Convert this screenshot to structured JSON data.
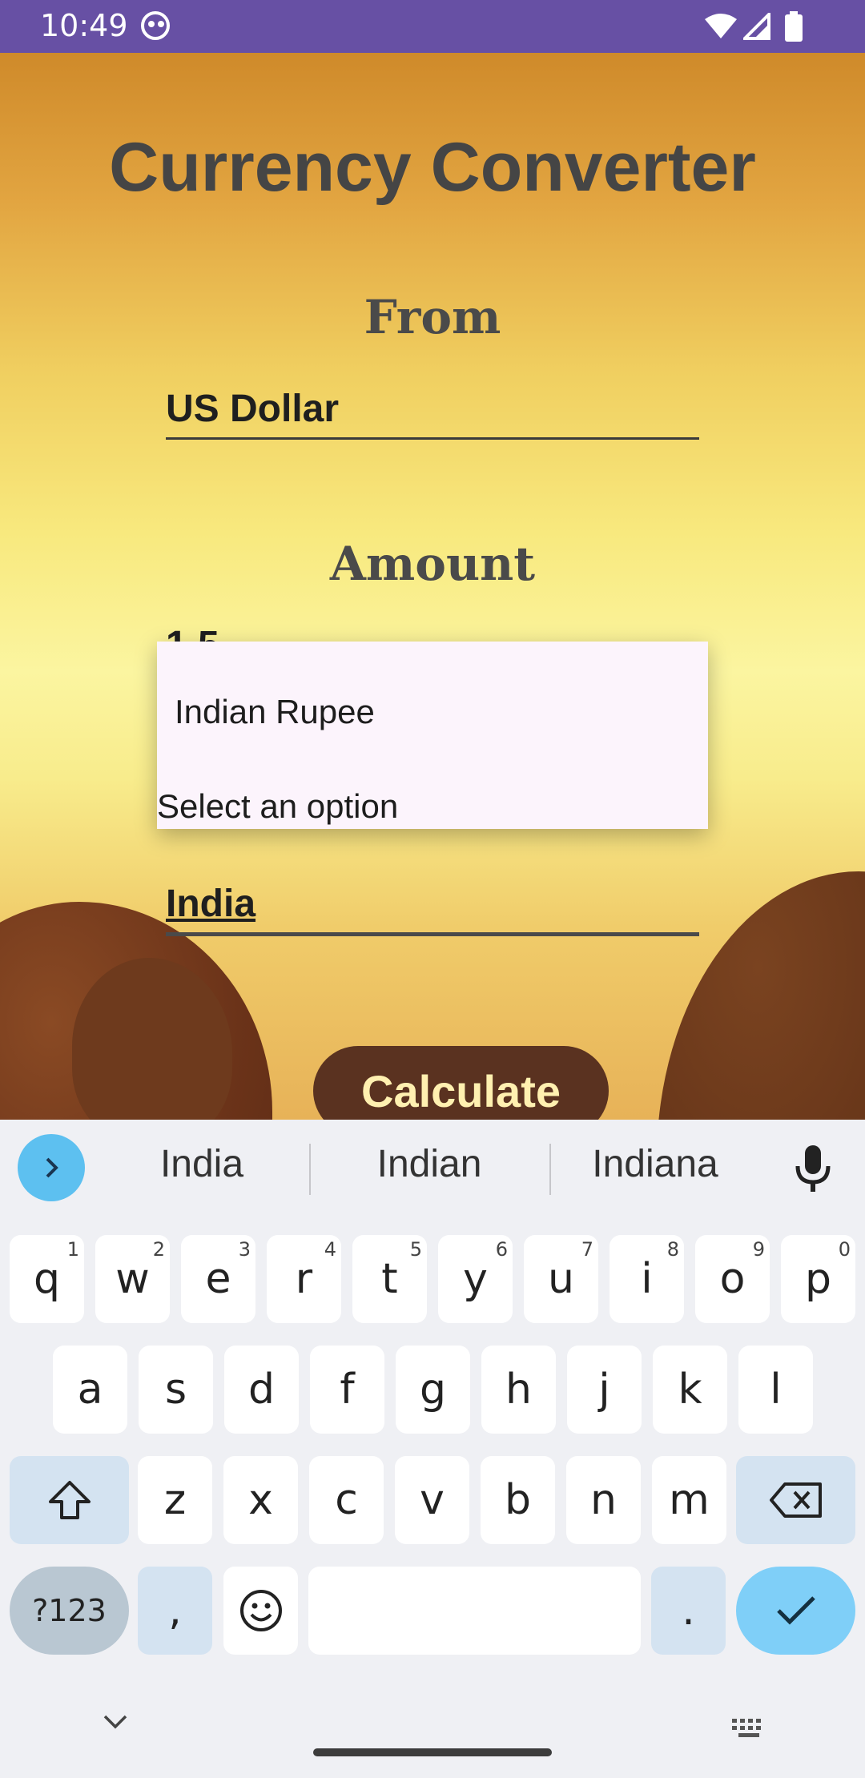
{
  "status_bar": {
    "time": "10:49"
  },
  "app": {
    "title": "Currency Converter",
    "from_label": "From",
    "from_value": "US Dollar",
    "amount_label": "Amount",
    "amount_value_partial": "1.5",
    "to_value": "India",
    "calculate_label": "Calculate"
  },
  "dropdown": {
    "option": "Indian Rupee",
    "hint": "Select an option"
  },
  "keyboard": {
    "suggestions": [
      "India",
      "Indian",
      "Indiana"
    ],
    "row1": [
      {
        "k": "q",
        "s": "1"
      },
      {
        "k": "w",
        "s": "2"
      },
      {
        "k": "e",
        "s": "3"
      },
      {
        "k": "r",
        "s": "4"
      },
      {
        "k": "t",
        "s": "5"
      },
      {
        "k": "y",
        "s": "6"
      },
      {
        "k": "u",
        "s": "7"
      },
      {
        "k": "i",
        "s": "8"
      },
      {
        "k": "o",
        "s": "9"
      },
      {
        "k": "p",
        "s": "0"
      }
    ],
    "row2": [
      "a",
      "s",
      "d",
      "f",
      "g",
      "h",
      "j",
      "k",
      "l"
    ],
    "row3": [
      "z",
      "x",
      "c",
      "v",
      "b",
      "n",
      "m"
    ],
    "symbols_label": "?123",
    "comma_label": ",",
    "period_label": ".",
    "accent_color": "#7fcff8"
  }
}
